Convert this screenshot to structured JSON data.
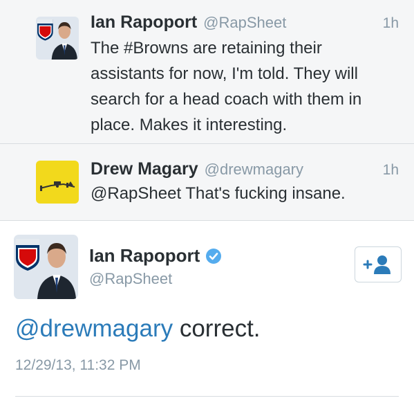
{
  "tweets": [
    {
      "name": "Ian Rapoport",
      "handle": "@RapSheet",
      "time": "1h",
      "text": "The #Browns are retaining their assistants for now, I'm told. They will search for a head coach with them in place. Makes it interesting."
    },
    {
      "name": "Drew Magary",
      "handle": "@drewmagary",
      "time": "1h",
      "text": "@RapSheet That's fucking insane."
    }
  ],
  "main_tweet": {
    "name": "Ian Rapoport",
    "handle": "@RapSheet",
    "verified": true,
    "mention": "@drewmagary",
    "text_rest": " correct.",
    "timestamp": "12/29/13, 11:32 PM",
    "follow_icon": "follow-user-icon"
  },
  "colors": {
    "link": "#2b7bb9",
    "secondary_text": "#8899a6",
    "verified": "#55acee",
    "nfl_blue": "#013369",
    "nfl_red": "#d50a0a",
    "drew_avatar_bg": "#f2d91c"
  },
  "icons": {
    "nfl_logo": "nfl-shield-icon",
    "verified": "verified-badge-icon"
  }
}
